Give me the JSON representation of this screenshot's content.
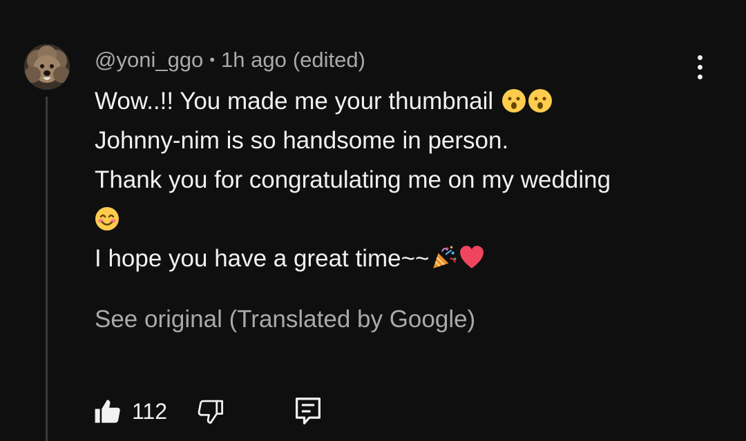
{
  "comment": {
    "author": "@yoni_ggo",
    "separator": "•",
    "time": "1h ago",
    "edited": "(edited)",
    "lines": [
      "Wow..!! You made me your thumbnail ",
      "Johnny-nim is so handsome in person.",
      "Thank you for congratulating me on my wedding",
      "",
      "I hope you have a great time~~"
    ],
    "see_original": "See original (Translated by Google)"
  },
  "actions": {
    "like_count": "112"
  },
  "icons": {
    "avatar": "poodle-avatar",
    "more": "more-vertical-icon",
    "like": "thumbs-up-icon",
    "dislike": "thumbs-down-icon",
    "reply": "reply-comment-icon",
    "emojis": [
      "hushed-face-emoji",
      "hushed-face-emoji",
      "smiling-face-emoji",
      "party-popper-emoji",
      "red-heart-emoji"
    ]
  },
  "colors": {
    "background": "#0f0f0f",
    "primary_text": "#f1f1f1",
    "secondary_text": "#aaaaaa",
    "emoji_yellow": "#ffcc4d",
    "heart_red": "#f0455f"
  }
}
